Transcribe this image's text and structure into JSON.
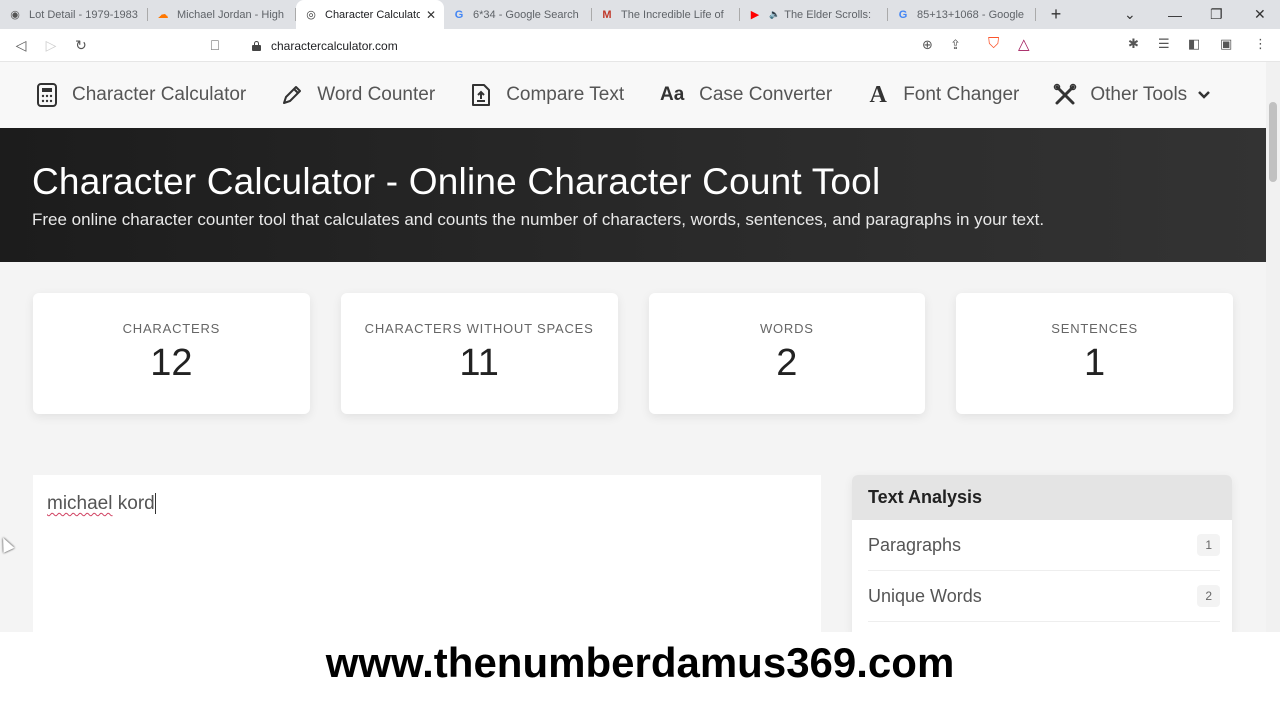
{
  "browser": {
    "tabs": [
      {
        "title": "Lot Detail - 1979-1983",
        "icon": "globe-icon",
        "glyph": "◉",
        "color": "#555"
      },
      {
        "title": "Michael Jordan - High",
        "icon": "soundcloud-icon",
        "glyph": "☁",
        "color": "#ff7700"
      },
      {
        "title": "Character Calculator",
        "icon": "charactercalculator-icon",
        "glyph": "◎",
        "color": "#333",
        "active": true
      },
      {
        "title": "6*34 - Google Search",
        "icon": "google-icon",
        "glyph": "G",
        "color": "#4285f4"
      },
      {
        "title": "The Incredible Life of",
        "icon": "m-site-icon",
        "glyph": "M",
        "color": "#c0392b"
      },
      {
        "title": "The Elder Scrolls:",
        "icon": "youtube-icon",
        "glyph": "▶",
        "color": "#ff0000",
        "audio": "🔈"
      },
      {
        "title": "85+13+1068 - Google",
        "icon": "google-icon",
        "glyph": "G",
        "color": "#4285f4"
      }
    ],
    "url": "charactercalculator.com",
    "new_tab": "+",
    "tab_list": "⌄",
    "minimize": "—",
    "restore": "❐",
    "close": "✕"
  },
  "nav": {
    "items": [
      {
        "label": "Character Calculator",
        "icon": "calculator-icon",
        "glyph": "🖩"
      },
      {
        "label": "Word Counter",
        "icon": "pencil-icon",
        "glyph": "✎"
      },
      {
        "label": "Compare Text",
        "icon": "file-upload-icon",
        "glyph": "⎘"
      },
      {
        "label": "Case Converter",
        "icon": "case-icon",
        "glyph": "Aa"
      },
      {
        "label": "Font Changer",
        "icon": "font-icon",
        "glyph": "A"
      },
      {
        "label": "Other Tools",
        "icon": "tools-icon",
        "glyph": "✂",
        "chevron": "⌄"
      }
    ]
  },
  "hero": {
    "title": "Character Calculator - Online Character Count Tool",
    "subtitle": "Free online character counter tool that calculates and counts the number of characters, words, sentences, and paragraphs in your text."
  },
  "stats": [
    {
      "label": "CHARACTERS",
      "value": "12"
    },
    {
      "label": "CHARACTERS WITHOUT SPACES",
      "value": "11"
    },
    {
      "label": "WORDS",
      "value": "2"
    },
    {
      "label": "SENTENCES",
      "value": "1"
    }
  ],
  "editor": {
    "word1": "michael",
    "word2": " kord"
  },
  "analysis": {
    "title": "Text Analysis",
    "rows": [
      {
        "label": "Paragraphs",
        "value": "1"
      },
      {
        "label": "Unique Words",
        "value": "2"
      }
    ]
  },
  "watermark": "www.thenumberdamus369.com"
}
